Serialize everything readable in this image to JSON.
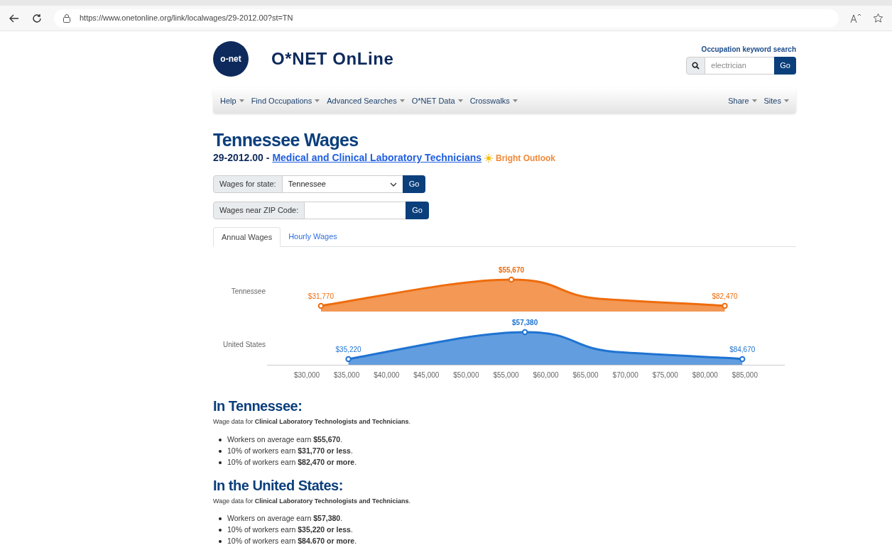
{
  "browser": {
    "url": "https://www.onetonline.org/link/localwages/29-2012.00?st=TN"
  },
  "header": {
    "logo_badge": "o-net",
    "site_title": "O*NET OnLine",
    "search": {
      "label": "Occupation keyword search",
      "placeholder": "electrician",
      "button": "Go"
    }
  },
  "nav": {
    "left": [
      "Help",
      "Find Occupations",
      "Advanced Searches",
      "O*NET Data",
      "Crosswalks"
    ],
    "right": [
      "Share",
      "Sites"
    ]
  },
  "page": {
    "title": "Tennessee Wages",
    "code": "29-2012.00 -",
    "occupation_link": "Medical and Clinical Laboratory Technicians",
    "badge": "Bright Outlook"
  },
  "filters": [
    {
      "label": "Wages for state:",
      "kind": "select",
      "value": "Tennessee",
      "button": "Go"
    },
    {
      "label": "Wages near ZIP Code:",
      "kind": "input",
      "button": "Go"
    }
  ],
  "tabs": [
    {
      "label": "Annual Wages",
      "selected": true
    },
    {
      "label": "Hourly Wages",
      "selected": false
    }
  ],
  "wage_chart": {
    "axis_ticks": [
      "$30,000",
      "$35,000",
      "$40,000",
      "$45,000",
      "$50,000",
      "$55,000",
      "$60,000",
      "$65,000",
      "$70,000",
      "$75,000",
      "$80,000",
      "$85,000"
    ],
    "rows": [
      {
        "name": "Tennessee",
        "color": "#ee6c0d",
        "labels": [
          "$31,770",
          "$55,670",
          "$82,470"
        ]
      },
      {
        "name": "United States",
        "color": "#1f73d1",
        "labels": [
          "$35,220",
          "$57,380",
          "$84,670"
        ]
      }
    ]
  },
  "sections": [
    {
      "heading": "In Tennessee:",
      "intro": "Wage data for **Clinical Laboratory Technologists and Technicians**.",
      "bullets": [
        "Workers on average earn **$55,670**.",
        "10% of workers earn **$31,770 or less**.",
        "10% of workers earn **$82,470 or more**."
      ]
    },
    {
      "heading": "In the United States:",
      "intro": "Wage data for **Clinical Laboratory Technologists and Technicians**.",
      "bullets": [
        "Workers on average earn **$57,380**.",
        "10% of workers earn **$35,220 or less**.",
        "10% of workers earn **$84.670 or more**."
      ]
    }
  ]
}
